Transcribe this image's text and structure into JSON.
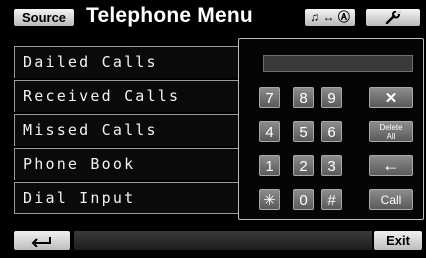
{
  "header": {
    "source_label": "Source",
    "title": "Telephone Menu",
    "mode_label": "♫ ↔ Ⓐ",
    "setup_icon": "wrench-icon"
  },
  "menu": {
    "items": [
      {
        "label": "Dailed Calls"
      },
      {
        "label": "Received Calls"
      },
      {
        "label": "Missed Calls"
      },
      {
        "label": "Phone Book"
      },
      {
        "label": "Dial Input"
      }
    ]
  },
  "keypad": {
    "display_value": "",
    "keys": {
      "k7": "7",
      "k8": "8",
      "k9": "9",
      "clear": "✕",
      "k4": "4",
      "k5": "5",
      "k6": "6",
      "delete_all_line1": "Delete",
      "delete_all_line2": "All",
      "k1": "1",
      "k2": "2",
      "k3": "3",
      "backspace": "←",
      "star": "✳",
      "k0": "0",
      "hash": "#",
      "call": "Call"
    }
  },
  "footer": {
    "back_icon": "return-arrow-icon",
    "exit_label": "Exit"
  }
}
